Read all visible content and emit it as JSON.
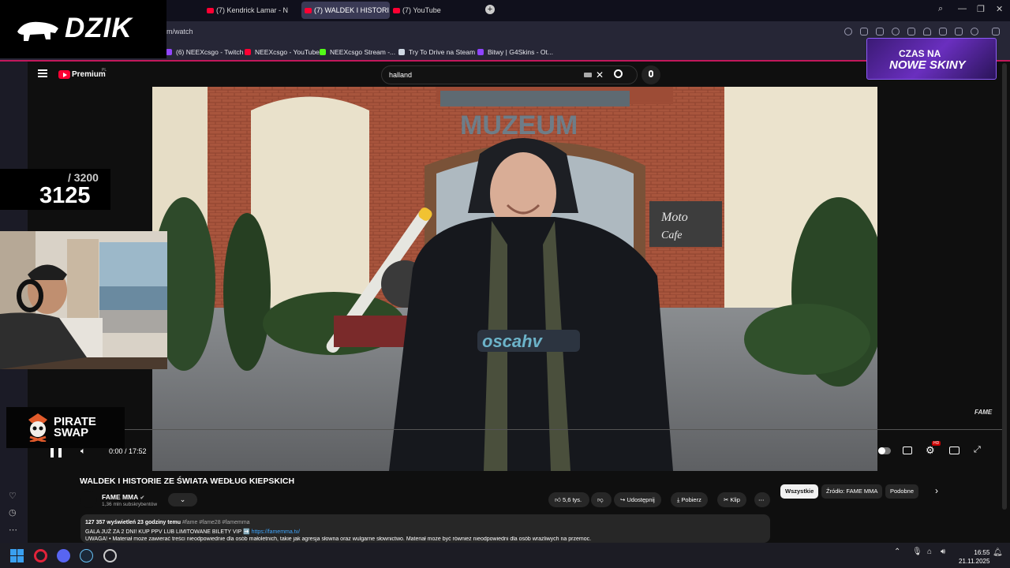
{
  "browser": {
    "tabs": [
      {
        "label": "(7) Kendrick Lamar - N",
        "active": false
      },
      {
        "label": "(7) WALDEK I HISTORI",
        "active": true
      },
      {
        "label": "(7) YouTube",
        "active": false
      }
    ],
    "url": "m/watch",
    "bookmarks": [
      "(6) NEEXcsgo - Twitch",
      "NEEXcsgo - YouTube",
      "NEEXcsgo Stream -...",
      "Try To Drive na Steam",
      "Bitwy | G4Skins - Ot..."
    ],
    "bookmark_colors": [
      "#9146ff",
      "#ff0033",
      "#53fc18",
      "#cfd8e3",
      "#8e44ff"
    ]
  },
  "overlays": {
    "brand_name": "DZIK",
    "counter_current": "3125",
    "counter_total": "/ 3200",
    "pirate_line1": "PIRATE",
    "pirate_line2": "SWAP",
    "promo_line1": "CZAS NA",
    "promo_line2": "NOWE SKINY"
  },
  "youtube": {
    "logo_text": "Premium",
    "logo_sup": "PL",
    "search_value": "halland",
    "video_watermark": "FAME",
    "time_display": "0:00 / 17:52",
    "quality_badge": "HD",
    "title": "WALDEK I HISTORIE ZE ŚWIATA WEDŁUG KIEPSKICH",
    "channel": "FAME MMA",
    "verified_icon": "✔",
    "subscribers": "1,36 mln subskrybentów",
    "likes": "5,6 tys.",
    "share_label": "Udostępnij",
    "download_label": "Pobierz",
    "clip_label": "Klip",
    "chips": [
      "Wszystkie",
      "Źródło: FAME MMA",
      "Podobne"
    ],
    "desc_stats": "127 357 wyświetleń  23 godziny temu",
    "desc_tags": "#fame #fame28 #famemma",
    "desc_line2": "GALA JUŻ ZA 2 DNI! KUP PPV LUB LIMITOWANE BILETY VIP ➡️",
    "desc_link": "https://famemma.tv/",
    "desc_line3": "UWAGA! • Materiał może zawierać treści nieodpowiednie dla osób małoletnich, takie jak agresja słowna oraz wulgarne słownictwo. Materiał może być również nieodpowiedni dla osób wrażliwych na przemoc."
  },
  "video_scene": {
    "sign_museum": "MUZEUM",
    "sign_moto": "Moto",
    "sign_cafe": "Cafe",
    "hoodie_print": "oscahv"
  },
  "taskbar": {
    "time": "16:55",
    "date": "21.11.2025"
  }
}
